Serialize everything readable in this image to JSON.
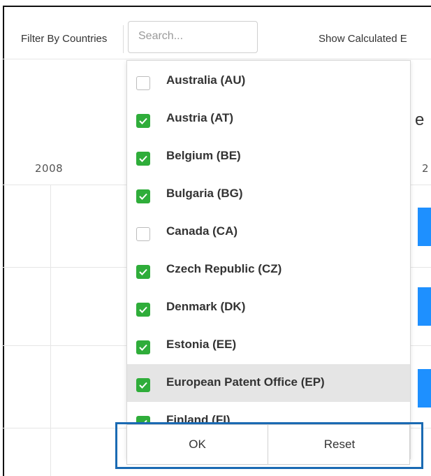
{
  "filter": {
    "label": "Filter By Countries",
    "search_placeholder": "Search...",
    "calculated_label": "Show Calculated E"
  },
  "chart_bg": {
    "year_left": "2008",
    "year_right": "2",
    "partial_title": "e",
    "bar_color": "#1e90ff"
  },
  "countries": [
    {
      "label": "Australia (AU)",
      "checked": false
    },
    {
      "label": "Austria (AT)",
      "checked": true
    },
    {
      "label": "Belgium (BE)",
      "checked": true
    },
    {
      "label": "Bulgaria (BG)",
      "checked": true
    },
    {
      "label": "Canada (CA)",
      "checked": false
    },
    {
      "label": "Czech Republic (CZ)",
      "checked": true
    },
    {
      "label": "Denmark (DK)",
      "checked": true
    },
    {
      "label": "Estonia (EE)",
      "checked": true
    },
    {
      "label": "European Patent Office (EP)",
      "checked": true,
      "highlighted": true
    },
    {
      "label": "Finland (FI)",
      "checked": true
    }
  ],
  "buttons": {
    "ok_label": "OK",
    "reset_label": "Reset"
  },
  "colors": {
    "check_green": "#2fad3a",
    "highlight_border": "#1a6ab3",
    "hover_bg": "#e5e5e5"
  }
}
